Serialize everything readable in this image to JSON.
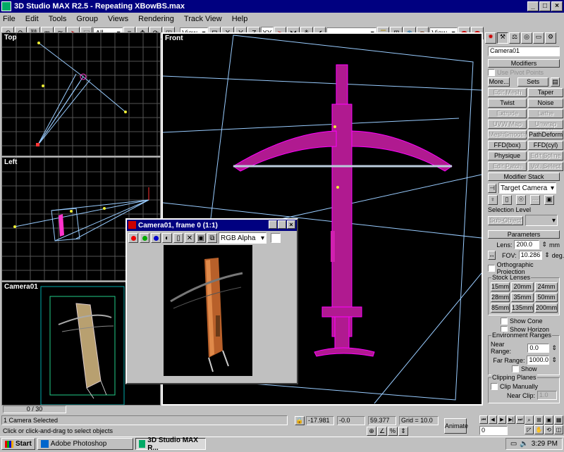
{
  "window": {
    "title": "3D Studio MAX R2.5 - Repeating XBowBS.max"
  },
  "menu": [
    "File",
    "Edit",
    "Tools",
    "Group",
    "Views",
    "Rendering",
    "Track View",
    "Help"
  ],
  "toolbar": {
    "selection_filter": "All",
    "ref_coord": "View",
    "axes": [
      "X",
      "Y",
      "Z",
      "XY"
    ],
    "named_sel": "",
    "render_view": "View"
  },
  "viewports": {
    "top": "Top",
    "left": "Left",
    "camera": "Camera01",
    "front": "Front"
  },
  "vfb": {
    "title": "Camera01, frame 0 (1:1)",
    "channel": "RGB Alpha"
  },
  "cmd": {
    "object_name": "Camera01",
    "modifiers_header": "Modifiers",
    "use_pivot": "Use Pivot Points",
    "more": "More...",
    "sets": "Sets",
    "mod_buttons": [
      "Edit Mesh",
      "Taper",
      "Twist",
      "Noise",
      "Extrude",
      "Lathe",
      "UVW Map",
      "Unwrap UVW",
      "MeshSmooth",
      "PathDeform",
      "FFD(box)",
      "FFD(cyl)",
      "Physique",
      "Edit Spline",
      "Edit Patch",
      "Vol. Select"
    ],
    "mod_disabled": [
      true,
      false,
      false,
      false,
      true,
      true,
      true,
      true,
      true,
      false,
      false,
      false,
      false,
      true,
      true,
      true
    ],
    "stack_header": "Modifier Stack",
    "stack_value": "Target Camera",
    "sel_level": "Selection Level",
    "sub_object": "Sub-Object",
    "params_header": "Parameters",
    "lens_label": "Lens:",
    "lens_value": "200.0",
    "lens_unit": "mm",
    "fov_label": "FOV:",
    "fov_value": "10.286",
    "fov_unit": "deg.",
    "ortho": "Orthographic Projection",
    "stock_label": "Stock Lenses",
    "lenses": [
      "15mm",
      "20mm",
      "24mm",
      "28mm",
      "35mm",
      "50mm",
      "85mm",
      "135mm",
      "200mm"
    ],
    "show_cone": "Show Cone",
    "show_horizon": "Show Horizon",
    "env_label": "Environment Ranges",
    "near_range_label": "Near Range:",
    "near_range": "0.0",
    "far_range_label": "Far Range:",
    "far_range": "1000.0",
    "show": "Show",
    "clip_label": "Clipping Planes",
    "clip_manually": "Clip Manually",
    "near_clip_label": "Near Clip:",
    "near_clip": "1.0"
  },
  "status": {
    "selection": "1 Camera Selected",
    "prompt": "Click or click-and-drag to select objects",
    "x": "-17.981",
    "y": "-0.0",
    "z": "59.377",
    "grid": "Grid = 10.0",
    "frame": "0 / 30",
    "animate": "Animate",
    "frame_field": "0"
  },
  "taskbar": {
    "start": "Start",
    "tasks": [
      "Adobe Photoshop",
      "3D Studio MAX R..."
    ],
    "clock": "3:29 PM"
  }
}
